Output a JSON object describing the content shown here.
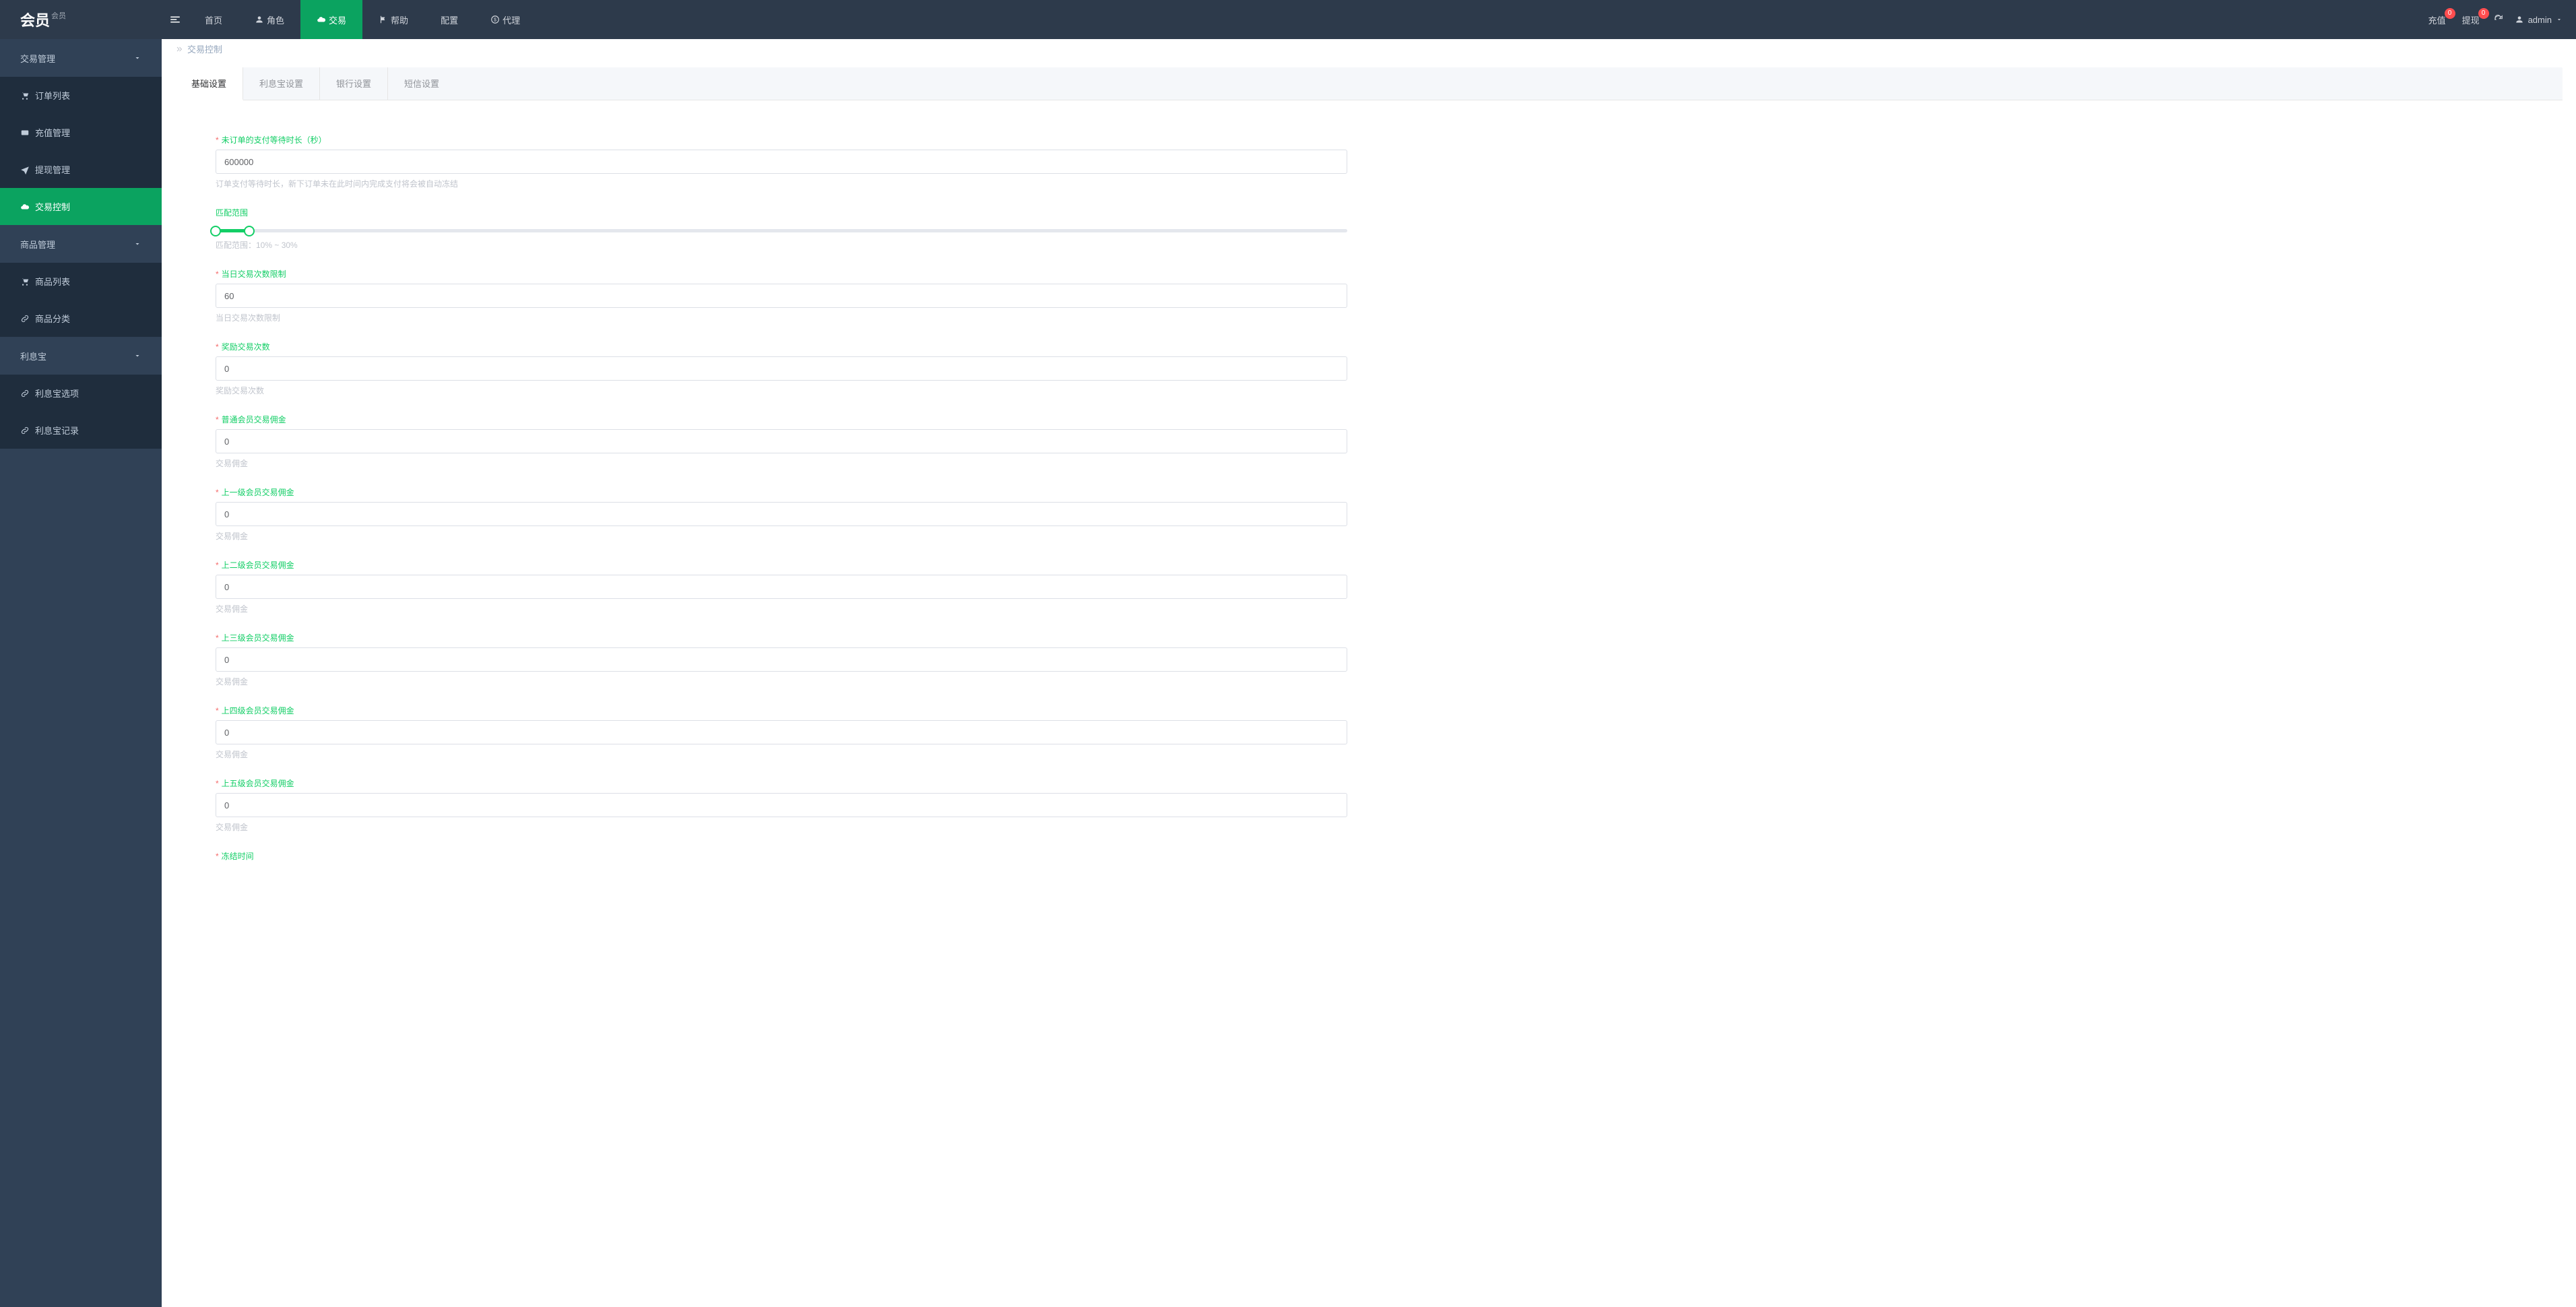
{
  "logo": {
    "main": "会员",
    "sub": "会员"
  },
  "topnav": {
    "home": "首页",
    "role": "角色",
    "trade": "交易",
    "help": "帮助",
    "config": "配置",
    "agent": "代理"
  },
  "topright": {
    "recharge": "充值",
    "recharge_badge": "0",
    "withdraw": "提现",
    "withdraw_badge": "0",
    "user": "admin"
  },
  "sidebar": {
    "group_trade": "交易管理",
    "item_orders": "订单列表",
    "item_recharge": "充值管理",
    "item_withdraw": "提现管理",
    "item_trade_ctrl": "交易控制",
    "group_goods": "商品管理",
    "item_goods_list": "商品列表",
    "item_goods_cat": "商品分类",
    "group_lixibao": "利息宝",
    "item_lxb_option": "利息宝选项",
    "item_lxb_record": "利息宝记录"
  },
  "breadcrumb": {
    "current": "交易控制"
  },
  "tabs": {
    "basic": "基础设置",
    "lixibao": "利息宝设置",
    "bank": "银行设置",
    "sms": "短信设置"
  },
  "form": {
    "f1_label": "未订单的支付等待时长（秒）",
    "f1_value": "600000",
    "f1_help": "订单支付等待时长，新下订单未在此时间内完成支付将会被自动冻结",
    "f2_label": "匹配范围",
    "f2_help": "匹配范围：10% ~ 30%",
    "f3_label": "当日交易次数限制",
    "f3_value": "60",
    "f3_help": "当日交易次数限制",
    "f4_label": "奖励交易次数",
    "f4_value": "0",
    "f4_help": "奖励交易次数",
    "f5_label": "普通会员交易佣金",
    "f5_value": "0",
    "f5_help": "交易佣金",
    "f6_label": "上一级会员交易佣金",
    "f6_value": "0",
    "f6_help": "交易佣金",
    "f7_label": "上二级会员交易佣金",
    "f7_value": "0",
    "f7_help": "交易佣金",
    "f8_label": "上三级会员交易佣金",
    "f8_value": "0",
    "f8_help": "交易佣金",
    "f9_label": "上四级会员交易佣金",
    "f9_value": "0",
    "f9_help": "交易佣金",
    "f10_label": "上五级会员交易佣金",
    "f10_value": "0",
    "f10_help": "交易佣金",
    "f11_label": "冻结时间"
  }
}
